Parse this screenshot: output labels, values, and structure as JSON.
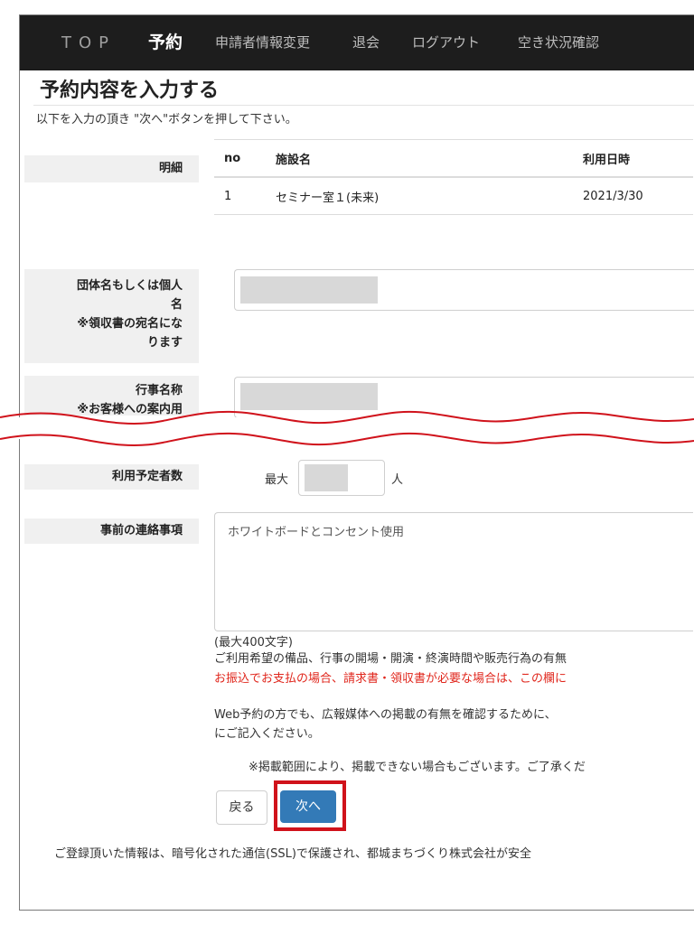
{
  "nav": {
    "top": "TOP",
    "reserve": "予約",
    "profile_edit": "申請者情報変更",
    "withdraw": "退会",
    "logout": "ログアウト",
    "availability": "空き状況確認"
  },
  "page": {
    "title": "予約内容を入力する",
    "subtitle": "以下を入力の頂き \"次へ\"ボタンを押して下さい。"
  },
  "details": {
    "label": "明細",
    "headers": [
      "no",
      "施設名",
      "利用日時"
    ],
    "rows": [
      [
        "1",
        "セミナー室１(未来)",
        "2021/3/30"
      ]
    ]
  },
  "fields": {
    "group_name_label": "団体名もしくは個人名\n※領収書の宛名になります",
    "event_name_label": "行事名称\n※お客様への案内用",
    "attendees_label": "利用予定者数",
    "attendees_prefix": "最大",
    "attendees_unit": "人",
    "notes_label": "事前の連絡事項",
    "notes_value": "ホワイトボードとコンセント使用"
  },
  "notes": {
    "max_chars": "(最大400文字)",
    "line1": "ご利用希望の備品、行事の開場・開演・終演時間や販売行為の有無",
    "line2_red": "お振込でお支払の場合、請求書・領収書が必要な場合は、この欄に",
    "line3": "Web予約の方でも、広報媒体への掲載の有無を確認するために、",
    "line3b": "にご記入ください。",
    "line4": "※掲載範囲により、掲載できない場合もございます。ご了承くだ"
  },
  "buttons": {
    "back": "戻る",
    "next": "次へ"
  },
  "footer": "ご登録頂いた情報は、暗号化された通信(SSL)で保護され、都城まちづくり株式会社が安全",
  "colors": {
    "navbar": "#1d1d1d",
    "primary": "#337ab7",
    "highlight": "#d0121b",
    "warning_text": "#e0261c"
  }
}
